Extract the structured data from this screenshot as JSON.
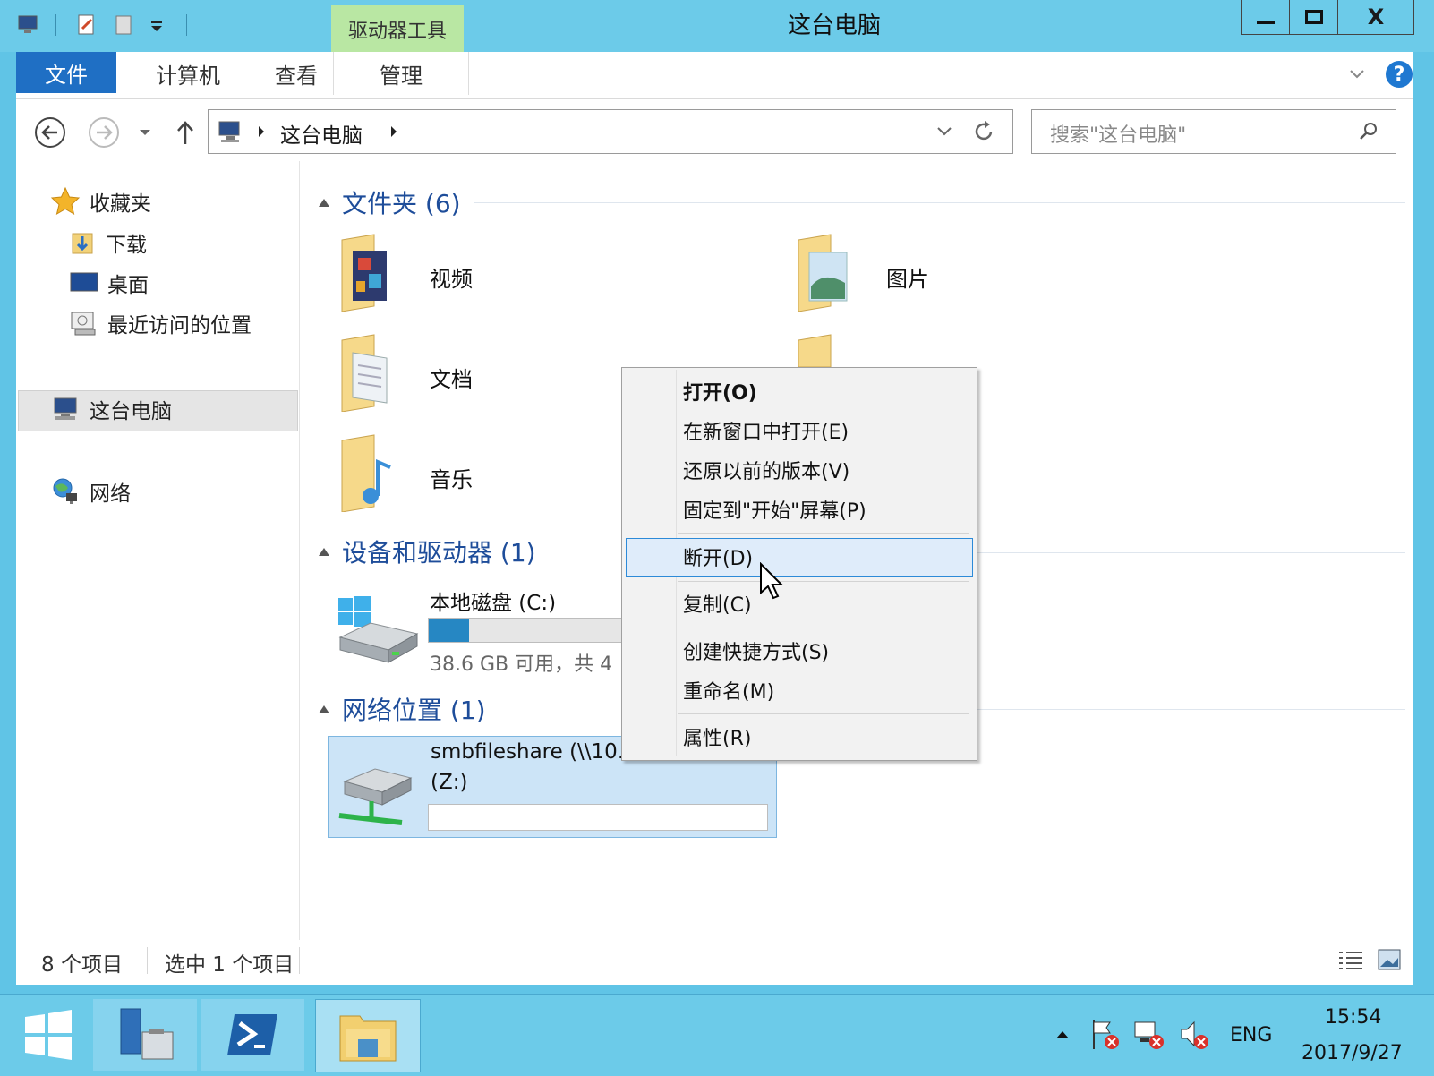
{
  "window": {
    "title": "这台电脑",
    "context_tab": "驱动器工具",
    "minimize_icon": "minimize-icon",
    "maximize_icon": "maximize-icon",
    "close_label": "X"
  },
  "ribbon": {
    "tabs": [
      "文件",
      "计算机",
      "查看",
      "管理"
    ],
    "help_icon": "?"
  },
  "address": {
    "breadcrumb": "这台电脑",
    "search_placeholder": "搜索\"这台电脑\""
  },
  "nav": {
    "favorites": "收藏夹",
    "downloads": "下载",
    "desktop": "桌面",
    "recent": "最近访问的位置",
    "this_pc": "这台电脑",
    "network": "网络"
  },
  "content": {
    "folders_header": "文件夹 (6)",
    "folders": [
      "视频",
      "图片",
      "文档",
      "音乐"
    ],
    "devices_header": "设备和驱动器 (1)",
    "drive_name": "本地磁盘 (C:)",
    "drive_free": "38.6 GB 可用，共 4",
    "drive_used_fraction": 0.18,
    "network_header": "网络位置 (1)",
    "net_name_line1": "smbfileshare (\\\\10.",
    "net_name_line2": "(Z:)"
  },
  "context_menu": {
    "items": [
      "打开(O)",
      "在新窗口中打开(E)",
      "还原以前的版本(V)",
      "固定到\"开始\"屏幕(P)",
      "断开(D)",
      "复制(C)",
      "创建快捷方式(S)",
      "重命名(M)",
      "属性(R)"
    ],
    "highlighted": "断开(D)"
  },
  "status": {
    "count": "8 个项目",
    "selected": "选中 1 个项目"
  },
  "taskbar": {
    "lang": "ENG",
    "time": "15:54",
    "date": "2017/9/27"
  }
}
